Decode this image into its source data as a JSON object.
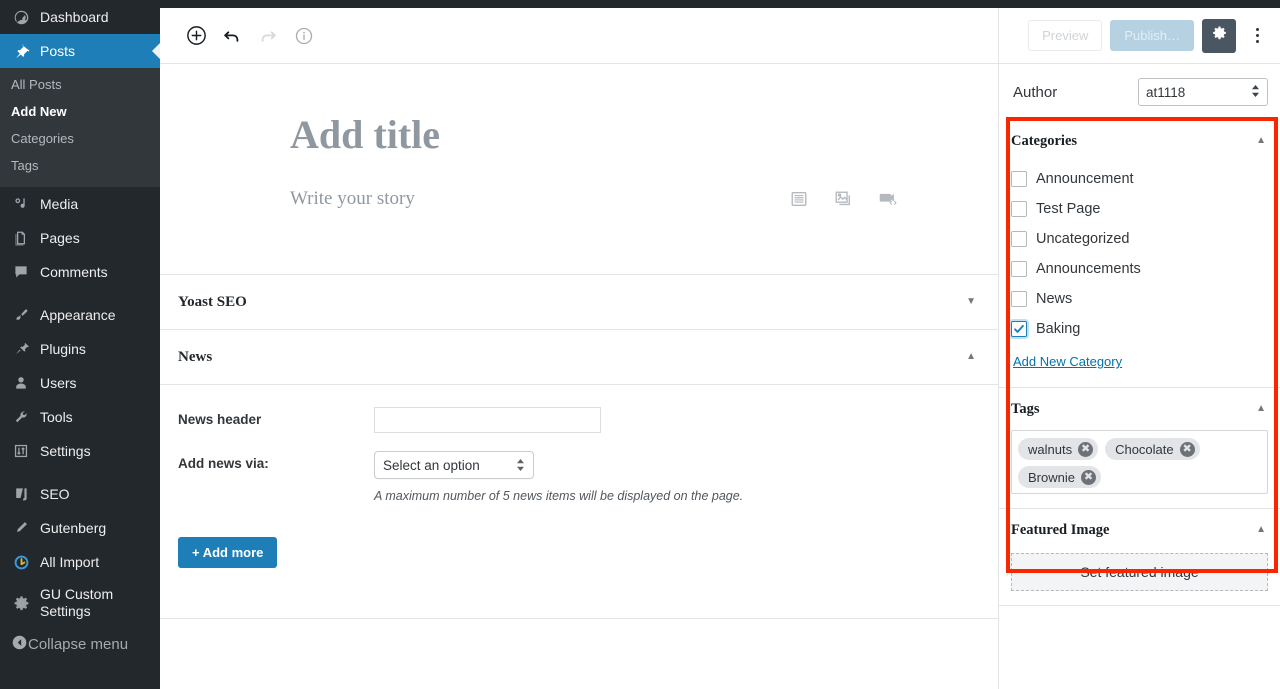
{
  "sidebar": {
    "items": [
      {
        "label": "Dashboard",
        "icon": "dashboard-icon",
        "active": false
      },
      {
        "label": "Posts",
        "icon": "pin-icon",
        "active": true
      },
      {
        "label": "Media",
        "icon": "media-icon",
        "active": false
      },
      {
        "label": "Pages",
        "icon": "pages-icon",
        "active": false
      },
      {
        "label": "Comments",
        "icon": "comment-icon",
        "active": false
      },
      {
        "label": "Appearance",
        "icon": "paintbrush-icon",
        "active": false
      },
      {
        "label": "Plugins",
        "icon": "plug-icon",
        "active": false
      },
      {
        "label": "Users",
        "icon": "user-icon",
        "active": false
      },
      {
        "label": "Tools",
        "icon": "wrench-icon",
        "active": false
      },
      {
        "label": "Settings",
        "icon": "sliders-icon",
        "active": false
      },
      {
        "label": "SEO",
        "icon": "yoast-icon",
        "active": false
      },
      {
        "label": "Gutenberg",
        "icon": "pencil-icon",
        "active": false
      },
      {
        "label": "All Import",
        "icon": "allimport-icon",
        "active": false
      },
      {
        "label": "GU Custom Settings",
        "icon": "gear-icon",
        "active": false
      }
    ],
    "posts_submenu": [
      {
        "label": "All Posts",
        "current": false
      },
      {
        "label": "Add New",
        "current": true
      },
      {
        "label": "Categories",
        "current": false
      },
      {
        "label": "Tags",
        "current": false
      }
    ],
    "collapse_label": "Collapse menu"
  },
  "toolbar": {
    "add_block": "add-block-icon",
    "undo": "undo-icon",
    "redo": "redo-icon",
    "info": "info-icon"
  },
  "publish_bar": {
    "preview_label": "Preview",
    "publish_label": "Publish…",
    "settings_icon": "gear-icon",
    "more_icon": "kebab-menu-icon"
  },
  "editor": {
    "title_placeholder": "Add title",
    "body_placeholder": "Write your story",
    "inline_icons": [
      {
        "name": "paragraph-list-icon"
      },
      {
        "name": "image-gallery-icon"
      },
      {
        "name": "embed-video-icon"
      }
    ]
  },
  "metaboxes": [
    {
      "title": "Yoast SEO",
      "expanded": false,
      "arrow": "▼"
    },
    {
      "title": "News",
      "expanded": true,
      "arrow": "▲",
      "fields": {
        "news_header_label": "News header",
        "news_header_value": "",
        "news_header_placeholder": "",
        "add_news_label": "Add news via:",
        "add_news_value": "Select an option",
        "helper_text": "A maximum number of 5 news items will be displayed on the page.",
        "add_more_label": "+ Add more"
      }
    }
  ],
  "right": {
    "author": {
      "label": "Author",
      "value": "at1118"
    },
    "categories": {
      "title": "Categories",
      "arrow": "▲",
      "items": [
        {
          "label": "Announcement",
          "checked": false
        },
        {
          "label": "Test Page",
          "checked": false
        },
        {
          "label": "Uncategorized",
          "checked": false
        },
        {
          "label": "Announcements",
          "checked": false
        },
        {
          "label": "News",
          "checked": false
        },
        {
          "label": "Baking",
          "checked": true
        }
      ],
      "add_new_link": "Add New Category"
    },
    "tags": {
      "title": "Tags",
      "arrow": "▲",
      "chips": [
        {
          "label": "walnuts"
        },
        {
          "label": "Chocolate"
        },
        {
          "label": "Brownie"
        }
      ]
    },
    "featured_image": {
      "title": "Featured Image",
      "arrow": "▲",
      "button_label": "Set featured image"
    }
  },
  "colors": {
    "sidebar_bg": "#23282d",
    "sidebar_submenu_bg": "#32373c",
    "accent_blue": "#1e7fb8",
    "link_blue": "#0073aa",
    "highlight_red": "#fa2600",
    "publish_disabled": "#b6d2e2",
    "gear_dark": "#4a5763"
  }
}
